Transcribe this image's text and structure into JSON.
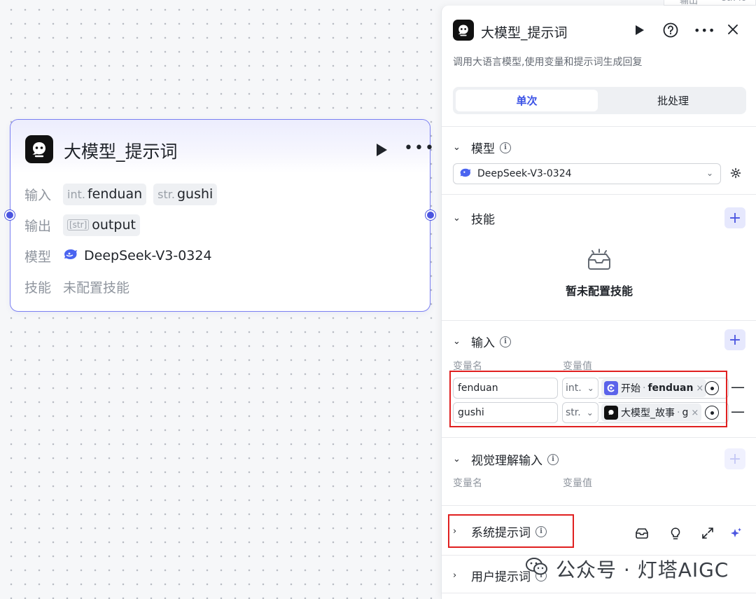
{
  "canvas_node": {
    "title": "大模型_提示词",
    "rows": [
      {
        "label": "输入",
        "params": [
          {
            "type": "int.",
            "name": "fenduan"
          },
          {
            "type": "str.",
            "name": "gushi"
          }
        ]
      },
      {
        "label": "输出",
        "params": [
          {
            "type": "[str]",
            "name": "output"
          }
        ]
      },
      {
        "label": "模型",
        "value": "DeepSeek-V3-0324"
      },
      {
        "label": "技能",
        "value": "未配置技能"
      }
    ]
  },
  "peek": {
    "label": "输出",
    "type": "str.",
    "name": "lo"
  },
  "panel": {
    "title": "大模型_提示词",
    "description": "调用大语言模型,使用变量和提示词生成回复",
    "tabs": {
      "single": "单次",
      "batch": "批处理"
    },
    "model": {
      "label": "模型",
      "selected": "DeepSeek-V3-0324"
    },
    "skills": {
      "label": "技能",
      "empty": "暂未配置技能"
    },
    "inputs": {
      "label": "输入",
      "col_name": "变量名",
      "col_value": "变量值",
      "rows": [
        {
          "name": "fenduan",
          "type": "int.",
          "ref_node": "开始",
          "ref_var": "fenduan",
          "ref_icon": "start-icon"
        },
        {
          "name": "gushi",
          "type": "str.",
          "ref_node": "大模型_故事",
          "ref_var": "g",
          "ref_icon": "llm-icon"
        }
      ]
    },
    "vision": {
      "label": "视觉理解输入",
      "col_name": "变量名",
      "col_value": "变量值"
    },
    "system_prompt": {
      "label": "系统提示词"
    },
    "user_prompt": {
      "label": "用户提示词"
    }
  },
  "watermark": {
    "text": "公众号 · 灯塔AIGC"
  },
  "colors": {
    "accent": "#4b55e0",
    "highlight": "#e02020"
  }
}
